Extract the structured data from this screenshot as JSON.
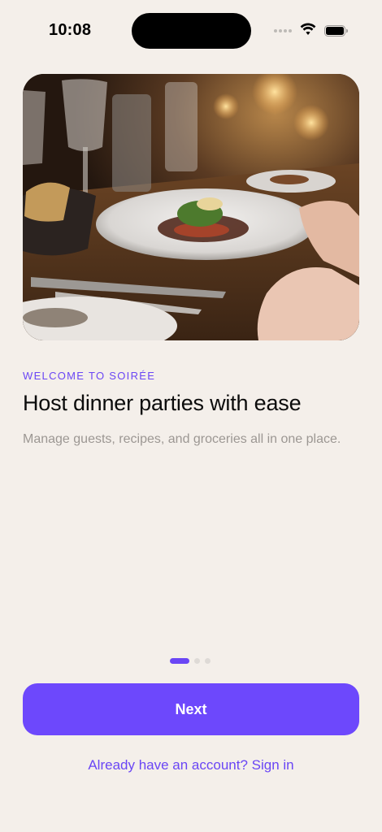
{
  "status_bar": {
    "time": "10:08",
    "icons": [
      "signal-dots-icon",
      "wifi-icon",
      "battery-icon"
    ]
  },
  "hero": {
    "image": "restaurant-dinner-table-photo"
  },
  "onboarding": {
    "eyebrow": "WELCOME TO SOIRÉE",
    "title": "Host dinner parties with ease",
    "subtitle": "Manage guests, recipes, and groceries all in one place.",
    "page_count": 3,
    "current_page": 1
  },
  "actions": {
    "next_label": "Next",
    "signin_label": "Already have an account? Sign in"
  },
  "colors": {
    "accent": "#6d48fc",
    "background": "#f4efea",
    "muted_text": "#9c9793"
  }
}
